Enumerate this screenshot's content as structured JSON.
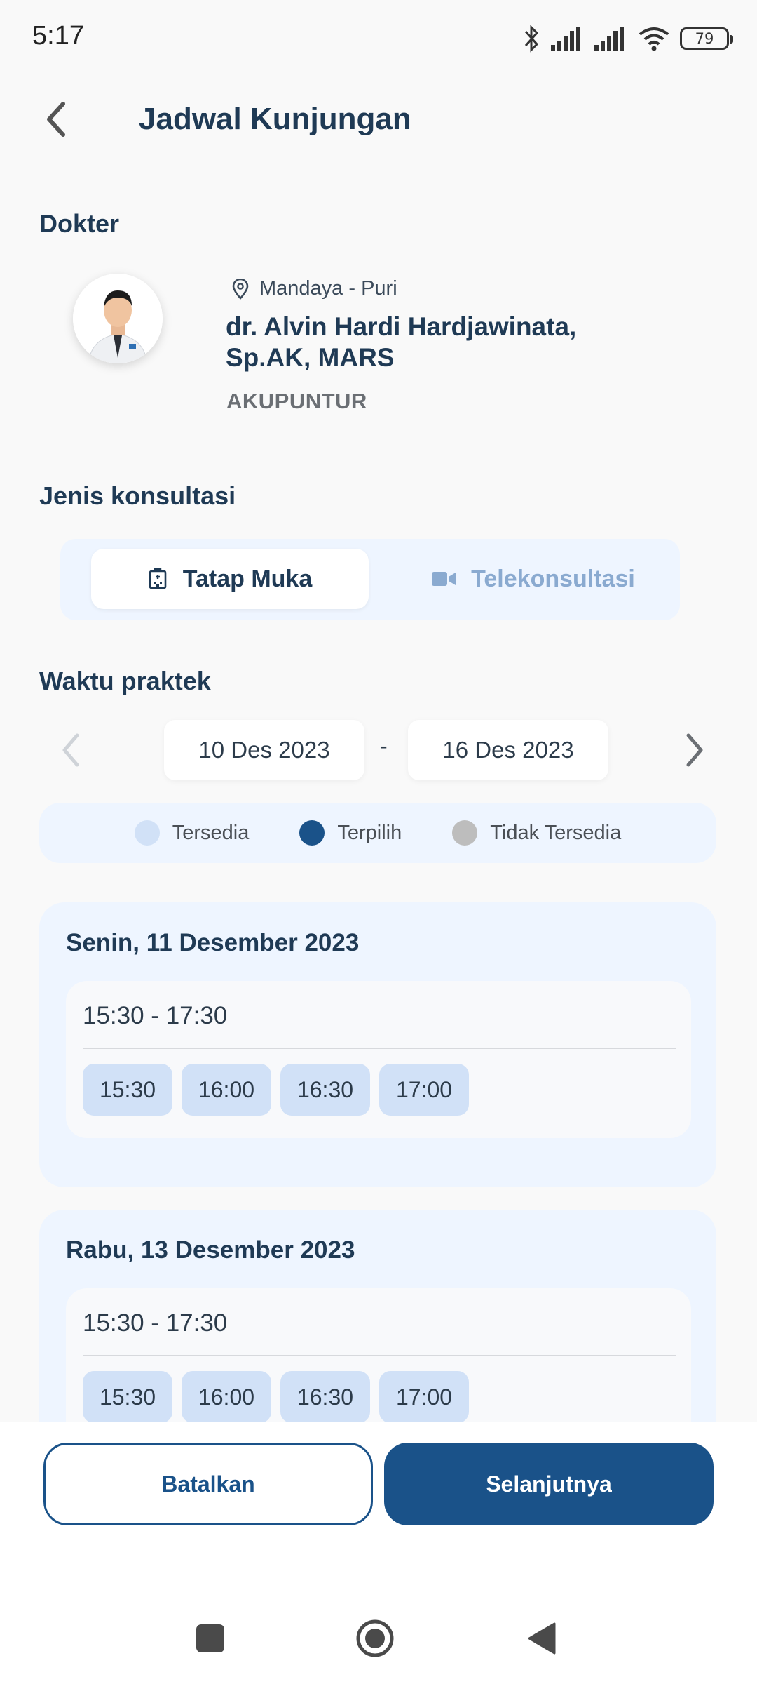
{
  "status_bar": {
    "time": "5:17",
    "battery": "79"
  },
  "header": {
    "title": "Jadwal Kunjungan"
  },
  "doctor_section": {
    "label": "Dokter",
    "location": "Mandaya - Puri",
    "name_line1": "dr. Alvin Hardi Hardjawinata,",
    "name_line2": "Sp.AK, MARS",
    "specialty": "AKUPUNTUR"
  },
  "consultation": {
    "label": "Jenis konsultasi",
    "options": [
      {
        "label": "Tatap Muka",
        "icon": "hospital-icon",
        "selected": true
      },
      {
        "label": "Telekonsultasi",
        "icon": "video-icon",
        "selected": false
      }
    ]
  },
  "schedule": {
    "label": "Waktu praktek",
    "date_from": "10 Des 2023",
    "separator": "-",
    "date_to": "16 Des 2023"
  },
  "legend": [
    {
      "label": "Tersedia",
      "color": "#d1e1f7"
    },
    {
      "label": "Terpilih",
      "color": "#1a5289"
    },
    {
      "label": "Tidak Tersedia",
      "color": "#bdbdbd"
    }
  ],
  "days": [
    {
      "title": "Senin, 11 Desember 2023",
      "range": "15:30 - 17:30",
      "slots": [
        "15:30",
        "16:00",
        "16:30",
        "17:00"
      ]
    },
    {
      "title": "Rabu, 13 Desember 2023",
      "range": "15:30 - 17:30",
      "slots": [
        "15:30",
        "16:00",
        "16:30",
        "17:00"
      ]
    }
  ],
  "actions": {
    "cancel": "Batalkan",
    "next": "Selanjutnya"
  },
  "colors": {
    "primary": "#1a5289",
    "text": "#1f3a55",
    "panel": "#eef5ff",
    "chip": "#d1e1f7"
  }
}
